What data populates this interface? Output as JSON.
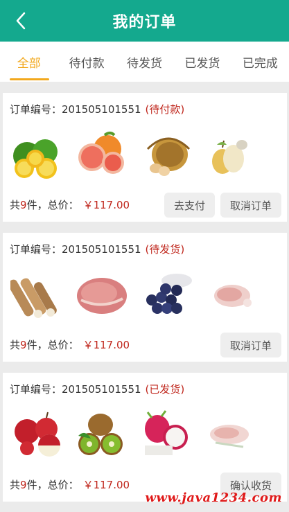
{
  "header": {
    "title": "我的订单",
    "back_icon": "chevron-left-icon",
    "background": "#14a98e"
  },
  "tabs": [
    {
      "label": "全部",
      "active": true
    },
    {
      "label": "待付款",
      "active": false
    },
    {
      "label": "待发货",
      "active": false
    },
    {
      "label": "已发货",
      "active": false
    },
    {
      "label": "已完成",
      "active": false
    }
  ],
  "accent_color": "#f2a81d",
  "price_color": "#c0271d",
  "orders": [
    {
      "number_label": "订单编号：",
      "number": "201505101551",
      "status": "(待付款)",
      "products": [
        "oranges",
        "grapefruit",
        "egg-basket",
        "pears"
      ],
      "count_prefix": "共",
      "count": "9",
      "count_suffix": "件，总价：",
      "price": "￥117.00",
      "actions": [
        "去支付",
        "取消订单"
      ]
    },
    {
      "number_label": "订单编号：",
      "number": "201505101551",
      "status": "(待发货)",
      "products": [
        "yam",
        "pork",
        "blueberries",
        "meat"
      ],
      "count_prefix": "共",
      "count": "9",
      "count_suffix": "件，总价：",
      "price": "￥117.00",
      "actions": [
        "取消订单"
      ]
    },
    {
      "number_label": "订单编号：",
      "number": "201505101551",
      "status": "(已发货)",
      "products": [
        "apples",
        "kiwi",
        "dragonfruit",
        "meat-slice"
      ],
      "count_prefix": "共",
      "count": "9",
      "count_suffix": "件，总价：",
      "price": "￥117.00",
      "actions": [
        "确认收货"
      ]
    }
  ],
  "watermark": "www.java1234.com"
}
